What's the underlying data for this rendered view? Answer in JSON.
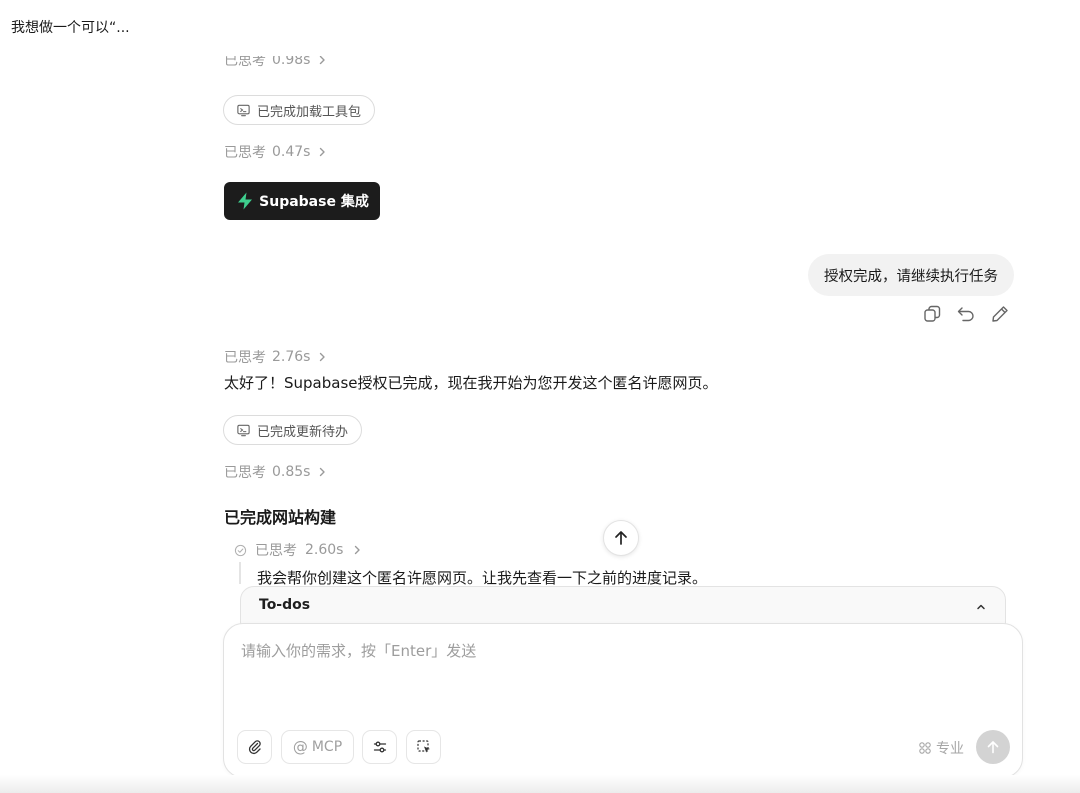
{
  "conversation": {
    "title": "我想做一个可以“..."
  },
  "thinking": {
    "label": "已思考",
    "durations": [
      "0.98s",
      "0.47s",
      "2.76s",
      "0.85s",
      "2.60s"
    ]
  },
  "tools": {
    "load_toolkit": "已完成加载工具包",
    "update_todos": "已完成更新待办"
  },
  "integration_button": {
    "label": "Supabase 集成",
    "icon_color": "#3ECF8E"
  },
  "user_message": {
    "text": "授权完成，请继续执行任务"
  },
  "assistant_message": {
    "text": "太好了！Supabase授权已完成，现在我开始为您开发这个匿名许愿网页。"
  },
  "section": {
    "title": "已完成网站构建"
  },
  "substep": {
    "text": "我会帮你创建这个匿名许愿网页。让我先查看一下之前的进度记录。"
  },
  "todos": {
    "label": "To-dos"
  },
  "composer": {
    "placeholder": "请输入你的需求，按「Enter」发送",
    "value": "",
    "mcp_label": "MCP",
    "mode_label": "专业"
  },
  "icons": {
    "tool": "terminal-icon",
    "integration": "supabase-bolt-icon",
    "copy": "copy-icon",
    "undo": "undo-icon",
    "edit": "pencil-icon",
    "scroll_top": "arrow-up-icon",
    "collapse": "chevron-up-icon",
    "attach": "paperclip-icon",
    "mention": "at-icon",
    "settings": "sliders-icon",
    "select": "select-area-icon",
    "mode": "grid-icon",
    "send": "arrow-up-icon"
  },
  "colors": {
    "accent_dark": "#1c1c1c",
    "muted_text": "#9a9a9a",
    "bubble_bg": "#f2f2f2",
    "send_disabled": "#d3d3d3"
  }
}
